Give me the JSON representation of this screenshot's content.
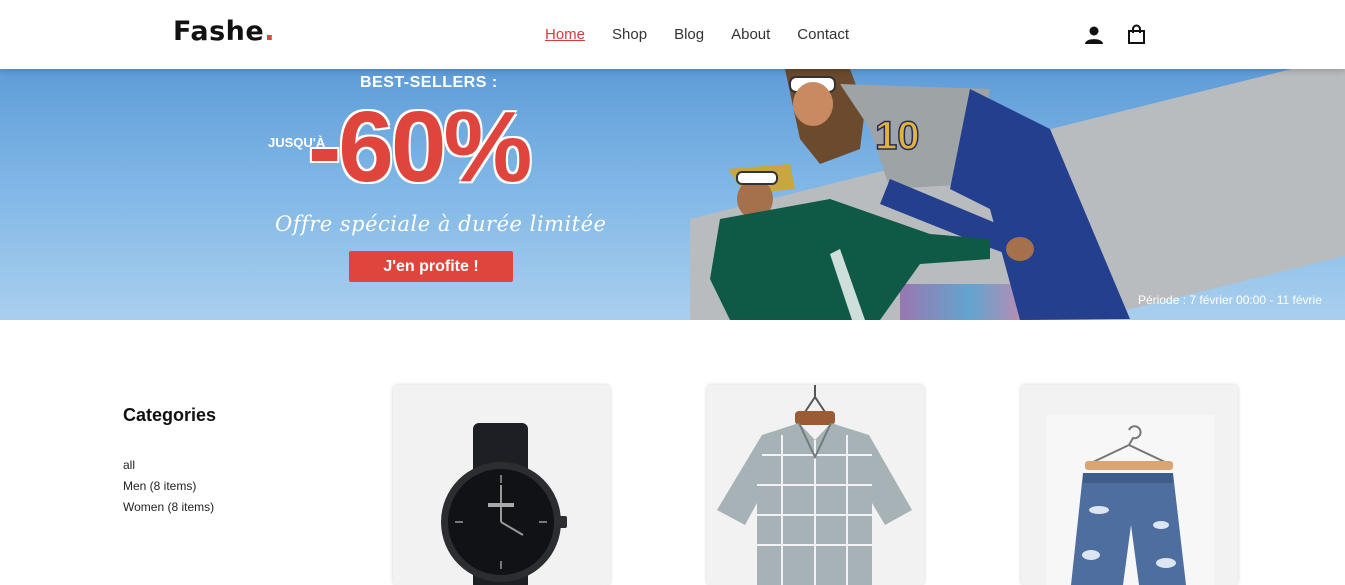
{
  "header": {
    "logo_text": "Fashe",
    "logo_dot": ".",
    "nav": [
      {
        "label": "Home",
        "active": true
      },
      {
        "label": "Shop",
        "active": false
      },
      {
        "label": "Blog",
        "active": false
      },
      {
        "label": "About",
        "active": false
      },
      {
        "label": "Contact",
        "active": false
      }
    ],
    "icons": [
      "user-icon",
      "shopping-bag-icon"
    ]
  },
  "banner": {
    "best_sellers": "BEST-SELLERS :",
    "jusqua": "JUSQU'À",
    "discount": "-60%",
    "offer": "Offre spéciale à durée limitée",
    "cta": "J'en profite !",
    "period": "Période : 7 février 00:00 - 11 févrie"
  },
  "sidebar": {
    "title": "Categories",
    "items": [
      "all",
      "Men (8 items)",
      "Women (8 items)"
    ]
  },
  "products": [
    {
      "name": "watch",
      "image": "watch-image"
    },
    {
      "name": "plaid shirt",
      "image": "shirt-image"
    },
    {
      "name": "denim shorts",
      "image": "shorts-image"
    }
  ],
  "colors": {
    "accent": "#e0453d",
    "nav_active": "#d73b3b",
    "banner_sky": "#7fb6e6"
  }
}
